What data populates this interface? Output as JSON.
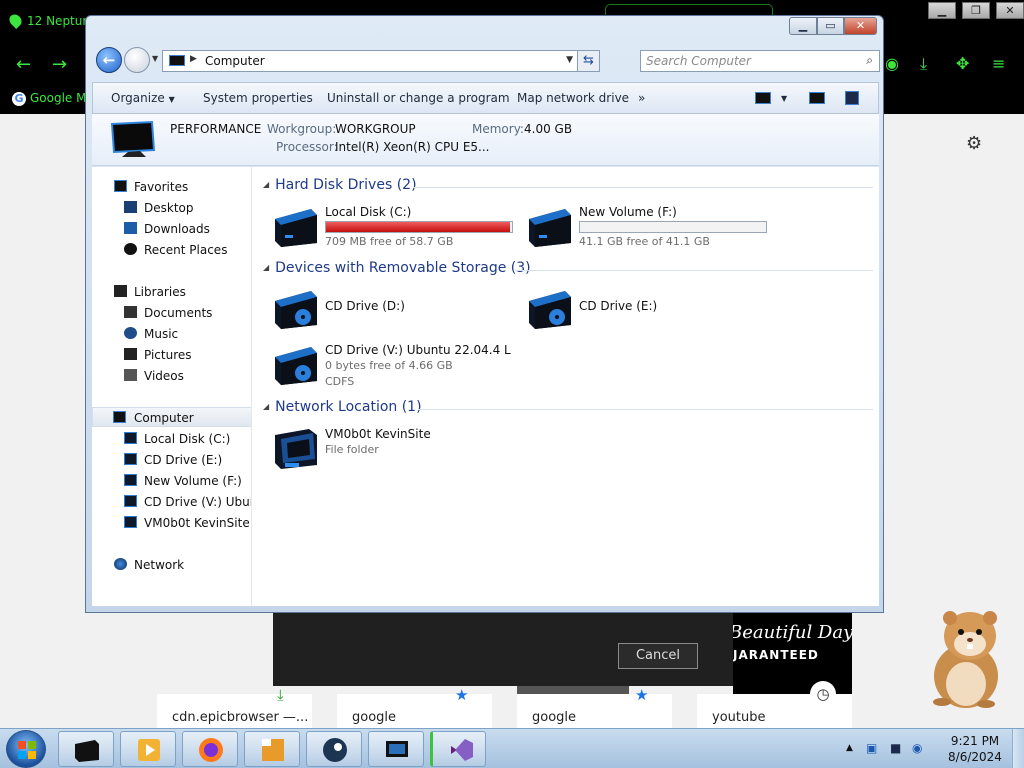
{
  "browser": {
    "tab_title": "12 Neptur",
    "bookmark_label": "Google M",
    "window_buttons": [
      "▁",
      "❐",
      "✕"
    ],
    "dialog": {
      "cancel_label": "Cancel"
    },
    "promo": {
      "line1": "Beautiful Day",
      "line2": "JARANTEED"
    },
    "tiles": [
      {
        "label": "cdn.epicbrowser —..."
      },
      {
        "label": "google"
      },
      {
        "label": "google"
      },
      {
        "label": "youtube"
      }
    ]
  },
  "explorer": {
    "caption_buttons": [
      "▁",
      "▭",
      "✕"
    ],
    "address": {
      "crumb": "Computer"
    },
    "search": {
      "placeholder": "Search Computer"
    },
    "commands": [
      "Organize",
      "System properties",
      "Uninstall or change a program",
      "Map network drive",
      "»"
    ],
    "details": {
      "computer_name": "PERFORMANCE",
      "workgroup_label": "Workgroup:",
      "workgroup": "WORKGROUP",
      "memory_label": "Memory:",
      "memory": "4.00 GB",
      "processor_label": "Processor:",
      "processor": "Intel(R) Xeon(R) CPU E5..."
    },
    "nav": {
      "favorites": "Favorites",
      "desktop": "Desktop",
      "downloads": "Downloads",
      "recent": "Recent Places",
      "libraries": "Libraries",
      "documents": "Documents",
      "music": "Music",
      "pictures": "Pictures",
      "videos": "Videos",
      "computer": "Computer",
      "local_c": "Local Disk (C:)",
      "cd_e": "CD Drive (E:)",
      "new_f": "New Volume (F:)",
      "cd_v": "CD Drive (V:) Ubuntu",
      "vm": "VM0b0t KevinSite",
      "network": "Network"
    },
    "groups": {
      "hdd": "Hard Disk Drives (2)",
      "removable": "Devices with Removable Storage (3)",
      "network": "Network Location (1)"
    },
    "drives": {
      "c": {
        "name": "Local Disk (C:)",
        "free": "709 MB free of 58.7 GB",
        "used_fraction": 0.988
      },
      "f": {
        "name": "New Volume (F:)",
        "free": "41.1 GB free of 41.1 GB",
        "used_fraction": 0.0
      },
      "d": {
        "name": "CD Drive (D:)"
      },
      "e": {
        "name": "CD Drive (E:)"
      },
      "v": {
        "name": "CD Drive (V:) Ubuntu 22.04.4 L",
        "free": "0 bytes free of 4.66 GB",
        "fs": "CDFS"
      },
      "vm": {
        "name": "VM0b0t KevinSite",
        "type": "File folder"
      }
    }
  },
  "taskbar": {
    "time": "9:21 PM",
    "date": "8/6/2024",
    "tray_arrow": "▲"
  },
  "colors": {
    "browser_accent": "#3ce63c",
    "drive_bar_full": "#c50e0e",
    "group_header": "#1e3a8a"
  }
}
